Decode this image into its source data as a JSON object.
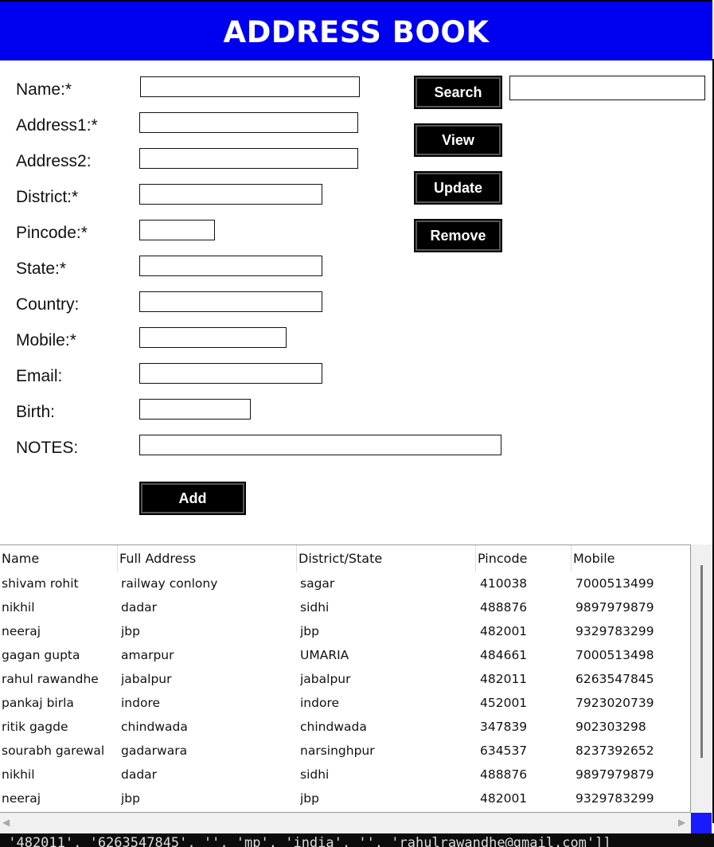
{
  "title": "ADDRESS BOOK",
  "form": {
    "labels": {
      "name": "Name:*",
      "address1": "Address1:*",
      "address2": "Address2:",
      "district": "District:*",
      "pincode": "Pincode:*",
      "state": "State:*",
      "country": "Country:",
      "mobile": "Mobile:*",
      "email": "Email:",
      "birth": "Birth:",
      "notes": "NOTES:"
    },
    "add_label": "Add"
  },
  "actions": {
    "search": "Search",
    "view": "View",
    "update": "Update",
    "remove": "Remove"
  },
  "table": {
    "headers": [
      "Name",
      "Full Address",
      "District/State",
      "Pincode",
      "Mobile"
    ],
    "rows": [
      [
        "shivam rohit",
        "railway conlony",
        "sagar",
        "410038",
        "7000513499"
      ],
      [
        "nikhil",
        "dadar",
        "sidhi",
        "488876",
        "9897979879"
      ],
      [
        "neeraj",
        "jbp",
        "jbp",
        "482001",
        "9329783299"
      ],
      [
        "gagan gupta",
        "amarpur",
        "UMARIA",
        "484661",
        "7000513498"
      ],
      [
        "rahul rawandhe",
        "jabalpur",
        "jabalpur",
        "482011",
        "6263547845"
      ],
      [
        "pankaj birla",
        "indore",
        "indore",
        "452001",
        "7923020739"
      ],
      [
        "ritik gagde",
        "chindwada",
        "chindwada",
        "347839",
        "902303298"
      ],
      [
        "sourabh garewal",
        "gadarwara",
        "narsinghpur",
        "634537",
        "8237392652"
      ],
      [
        "nikhil",
        "dadar",
        "sidhi",
        "488876",
        "9897979879"
      ],
      [
        "neeraj",
        "jbp",
        "jbp",
        "482001",
        "9329783299"
      ]
    ]
  },
  "console_text": " '482011', '6263547845', '', 'mp', 'india', '', 'rahulrawandhe@gmail.com']]",
  "colors": {
    "title_bg": "#0000f0",
    "button_bg": "#000000"
  }
}
